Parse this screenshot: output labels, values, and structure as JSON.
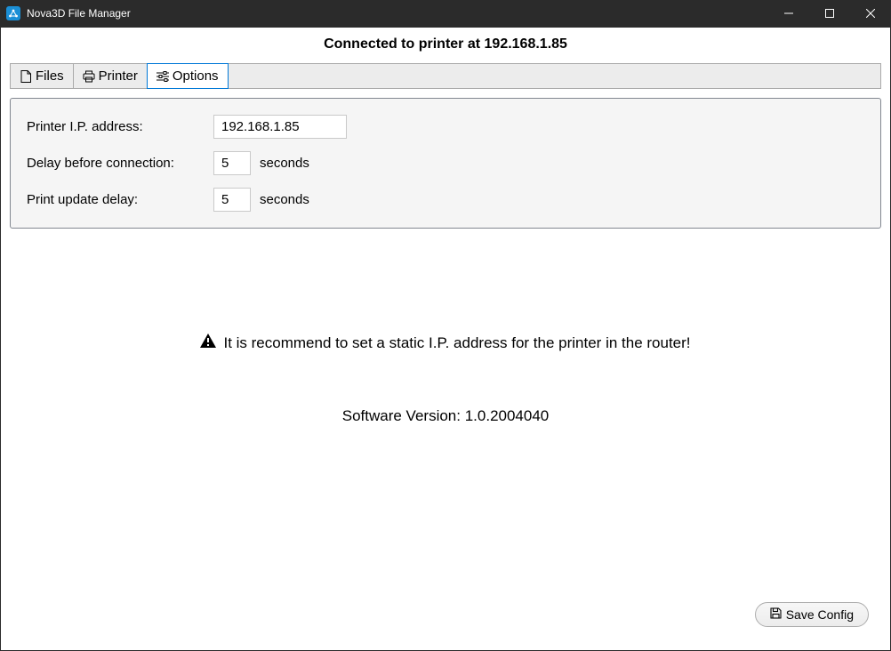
{
  "window": {
    "title": "Nova3D File Manager"
  },
  "status_header": "Connected to printer at 192.168.1.85",
  "tabs": {
    "files": "Files",
    "printer": "Printer",
    "options": "Options"
  },
  "form": {
    "ip_label": "Printer I.P. address:",
    "ip_value": "192.168.1.85",
    "delay_conn_label": "Delay before connection:",
    "delay_conn_value": "5",
    "delay_conn_suffix": "seconds",
    "update_delay_label": "Print update delay:",
    "update_delay_value": "5",
    "update_delay_suffix": "seconds"
  },
  "info": {
    "warning": "It is recommend to set a static I.P. address for the printer in the router!",
    "version": "Software Version: 1.0.2004040"
  },
  "footer": {
    "save_label": "Save Config"
  }
}
